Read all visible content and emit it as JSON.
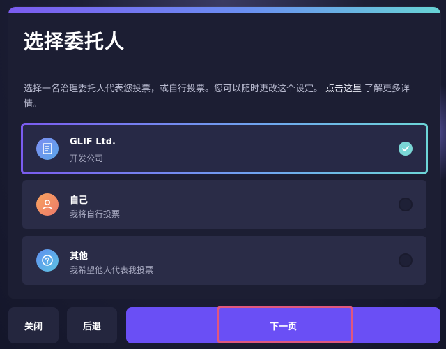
{
  "modal": {
    "title": "选择委托人",
    "description_before": "选择一名治理委托人代表您投票，或自行投票。您可以随时更改这个设定。",
    "description_link": "点击这里",
    "description_after": "了解更多详情。"
  },
  "options": [
    {
      "title": "GLIF Ltd.",
      "subtitle": "开发公司",
      "selected": true,
      "icon": "glif-logo-icon"
    },
    {
      "title": "自己",
      "subtitle": "我将自行投票",
      "selected": false,
      "icon": "user-icon"
    },
    {
      "title": "其他",
      "subtitle": "我希望他人代表我投票",
      "selected": false,
      "icon": "question-icon"
    }
  ],
  "footer": {
    "close_label": "关闭",
    "back_label": "后退",
    "next_label": "下一页"
  },
  "colors": {
    "accent": "#6a4ff5",
    "check": "#7ad7d6",
    "highlight": "#e0577e"
  }
}
